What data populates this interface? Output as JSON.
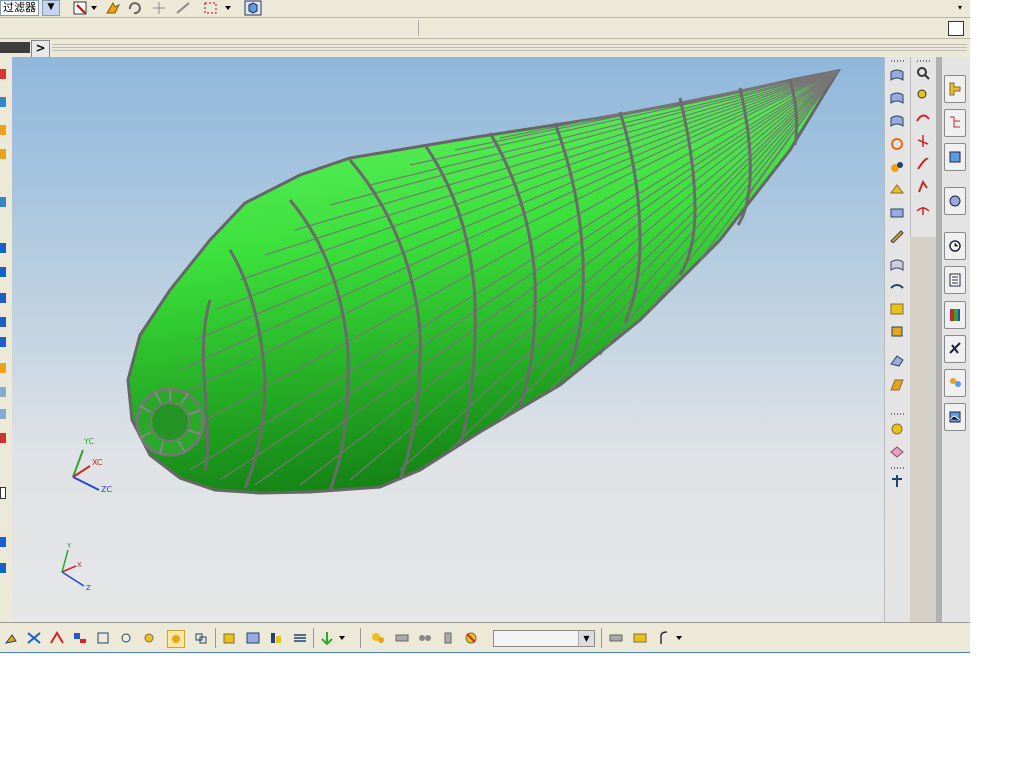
{
  "toolbar": {
    "filter_label": "过滤器",
    "filter_dropdown_arrow": "▼",
    "menu_arrow": "▾"
  },
  "breadcrumb_arrow": ">",
  "viewport": {
    "model_color": "#3ee83e",
    "wire_color": "#6f6f6f",
    "triad": {
      "yc": "YC",
      "xc": "XC",
      "zc": "ZC"
    },
    "absolute_triad": {
      "y": "Y",
      "x": "X",
      "z": "Z"
    }
  },
  "right_toolbar": {
    "col1_icons": [
      "surface-icon",
      "surface-icon",
      "surface-icon",
      "swept-icon",
      "blend-icon",
      "extension-icon",
      "offset-icon",
      "edit-surface-icon",
      "trim-icon",
      "sew-icon",
      "thicken-icon",
      "patch-icon",
      "shape-icon",
      "form-icon",
      "analysis-icon",
      "section-icon",
      "symbol-icon"
    ],
    "col2_icons": [
      "zoom-icon",
      "magnify-icon",
      "curve-icon",
      "curve-icon",
      "spline-icon",
      "bridge-icon",
      "fillet-curve-icon"
    ]
  },
  "resource_tabs": [
    "assembly-navigator-icon",
    "part-navigator-icon",
    "reuse-library-icon",
    "web-browser-icon",
    "history-icon",
    "system-material-icon",
    "palette-icon",
    "process-studio-icon",
    "roles-icon",
    "system-scenes-icon"
  ],
  "bottom_toolbar": {
    "icons": [
      "point-icon",
      "snap-icon",
      "intersect-icon",
      "quadrant-icon",
      "arc-center-icon",
      "tangent-icon",
      "control-icon",
      "selected-snap-icon",
      "grid-icon",
      "face-icon",
      "body-icon",
      "feature-icon",
      "layer-icon",
      "move-icon",
      "select-icon",
      "feature-select-icon",
      "component-icon",
      "face-select-icon",
      "body-select-icon",
      "curve-select-icon",
      "section-icon",
      "part-icon",
      "curve-icon"
    ],
    "dropdown_value": ""
  },
  "colors": {
    "chrome": "#ece9d8",
    "accent": "#4a86c5"
  }
}
